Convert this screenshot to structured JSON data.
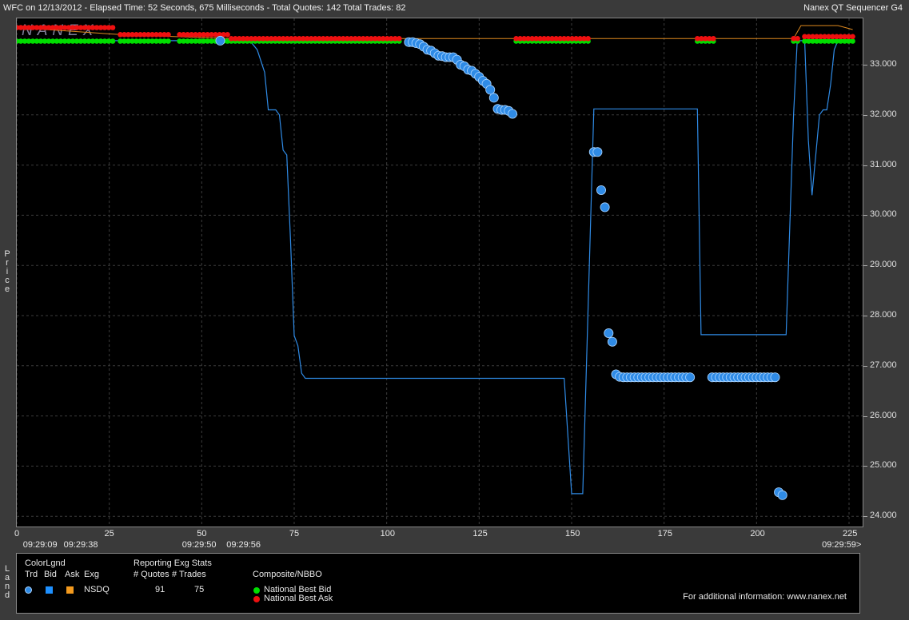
{
  "header": {
    "title": "WFC on 12/13/2012  -  Elapsed Time: 52 Seconds, 675 Milliseconds  -  Total Quotes: 142  Total Trades: 82",
    "app_name": "Nanex QT Sequencer G4",
    "watermark": "NANEX"
  },
  "side_labels": {
    "price": [
      "P",
      "r",
      "i",
      "c",
      "e"
    ],
    "land": [
      "L",
      "a",
      "n",
      "d"
    ]
  },
  "colors": {
    "plot_bg": "#000000",
    "trade": "#2f8be6",
    "trade_outline": "#a9d4ff",
    "bid": "#00dd00",
    "ask": "#ee1010",
    "line": "#2f8be6",
    "ask_line": "#e08a1e"
  },
  "legend": {
    "colorlgnd_title": "ColorLgnd",
    "col_trd": "Trd",
    "col_bid": "Bid",
    "col_ask": "Ask",
    "col_exg": "Exg",
    "exchange": "NSDQ",
    "stats_title": "Reporting Exg Stats",
    "stats_quotes_label": "# Quotes",
    "stats_trades_label": "# Trades",
    "quotes_value": "91",
    "trades_value": "75",
    "composite_title": "Composite/NBBO",
    "nbb_label": "National Best Bid",
    "nbo_label": "National Best Ask",
    "footer": "For additional information: www.nanex.net"
  },
  "chart_data": {
    "type": "scatter",
    "title": "WFC on 12/13/2012",
    "ylabel": "Price",
    "xlabel": "",
    "xlim": [
      0,
      228
    ],
    "ylim": [
      23.85,
      33.75
    ],
    "y_ticks": [
      "33.000",
      "32.000",
      "31.000",
      "30.000",
      "29.000",
      "28.000",
      "27.000",
      "26.000",
      "25.000",
      "24.000"
    ],
    "x_ticks": [
      "0",
      "25",
      "50",
      "75",
      "100",
      "125",
      "150",
      "175",
      "200",
      "225"
    ],
    "time_labels": [
      {
        "x": 6,
        "label": "09:29:09"
      },
      {
        "x": 17,
        "label": "09:29:38"
      },
      {
        "x": 49,
        "label": "09:29:50"
      },
      {
        "x": 61,
        "label": "09:29:56"
      },
      {
        "x": 222,
        "label": "09:29:59>"
      }
    ],
    "series": [
      {
        "name": "Trd",
        "kind": "trades",
        "points": [
          [
            55,
            33.48
          ],
          [
            106,
            33.45
          ],
          [
            107,
            33.45
          ],
          [
            108,
            33.43
          ],
          [
            109,
            33.41
          ],
          [
            110,
            33.36
          ],
          [
            111,
            33.3
          ],
          [
            112,
            33.28
          ],
          [
            113,
            33.23
          ],
          [
            114,
            33.18
          ],
          [
            115,
            33.17
          ],
          [
            116,
            33.15
          ],
          [
            117,
            33.15
          ],
          [
            118,
            33.15
          ],
          [
            119,
            33.1
          ],
          [
            120,
            33.0
          ],
          [
            121,
            32.97
          ],
          [
            122,
            32.9
          ],
          [
            123,
            32.88
          ],
          [
            124,
            32.82
          ],
          [
            125,
            32.76
          ],
          [
            126,
            32.68
          ],
          [
            127,
            32.62
          ],
          [
            128,
            32.5
          ],
          [
            129,
            32.34
          ],
          [
            130,
            32.12
          ],
          [
            131,
            32.1
          ],
          [
            132,
            32.1
          ],
          [
            133,
            32.08
          ],
          [
            134,
            32.02
          ],
          [
            156,
            31.26
          ],
          [
            157,
            31.26
          ],
          [
            158,
            30.5
          ],
          [
            159,
            30.16
          ],
          [
            160,
            27.65
          ],
          [
            161,
            27.48
          ],
          [
            162,
            26.83
          ],
          [
            163,
            26.78
          ],
          [
            164,
            26.77
          ],
          [
            165,
            26.77
          ],
          [
            166,
            26.77
          ],
          [
            167,
            26.77
          ],
          [
            168,
            26.77
          ],
          [
            169,
            26.77
          ],
          [
            170,
            26.77
          ],
          [
            171,
            26.77
          ],
          [
            172,
            26.77
          ],
          [
            173,
            26.77
          ],
          [
            174,
            26.77
          ],
          [
            175,
            26.77
          ],
          [
            176,
            26.77
          ],
          [
            177,
            26.77
          ],
          [
            178,
            26.77
          ],
          [
            179,
            26.77
          ],
          [
            180,
            26.77
          ],
          [
            181,
            26.77
          ],
          [
            182,
            26.77
          ],
          [
            188,
            26.77
          ],
          [
            189,
            26.77
          ],
          [
            190,
            26.77
          ],
          [
            191,
            26.77
          ],
          [
            192,
            26.77
          ],
          [
            193,
            26.77
          ],
          [
            194,
            26.77
          ],
          [
            195,
            26.77
          ],
          [
            196,
            26.77
          ],
          [
            197,
            26.77
          ],
          [
            198,
            26.77
          ],
          [
            199,
            26.77
          ],
          [
            200,
            26.77
          ],
          [
            201,
            26.77
          ],
          [
            202,
            26.77
          ],
          [
            203,
            26.77
          ],
          [
            204,
            26.77
          ],
          [
            205,
            26.77
          ],
          [
            206,
            24.48
          ],
          [
            207,
            24.42
          ]
        ]
      },
      {
        "name": "Trade line",
        "kind": "line",
        "points": [
          [
            0,
            33.48
          ],
          [
            63,
            33.48
          ],
          [
            65,
            33.3
          ],
          [
            67,
            32.85
          ],
          [
            68,
            32.1
          ],
          [
            70,
            32.1
          ],
          [
            71,
            32.0
          ],
          [
            72,
            31.3
          ],
          [
            73,
            31.2
          ],
          [
            74,
            29.5
          ],
          [
            75,
            27.6
          ],
          [
            76,
            27.4
          ],
          [
            77,
            26.85
          ],
          [
            78,
            26.75
          ],
          [
            148,
            26.75
          ],
          [
            150,
            24.45
          ],
          [
            153,
            24.45
          ],
          [
            156,
            32.12
          ],
          [
            184,
            32.12
          ],
          [
            185,
            27.62
          ],
          [
            208,
            27.62
          ],
          [
            210,
            32.0
          ],
          [
            211,
            33.48
          ],
          [
            213,
            33.48
          ],
          [
            214,
            31.5
          ],
          [
            215,
            30.4
          ],
          [
            216,
            31.2
          ],
          [
            217,
            32.0
          ],
          [
            218,
            32.1
          ],
          [
            219,
            32.1
          ],
          [
            220,
            32.6
          ],
          [
            221,
            33.3
          ],
          [
            222,
            33.48
          ],
          [
            226,
            33.48
          ]
        ]
      },
      {
        "name": "National Best Ask",
        "kind": "ask",
        "color": "#ee1010",
        "segments": [
          [
            0,
            27,
            33.74
          ],
          [
            28,
            42,
            33.6
          ],
          [
            44,
            57,
            33.6
          ],
          [
            58,
            104,
            33.52
          ],
          [
            135,
            155,
            33.52
          ],
          [
            184,
            189,
            33.52
          ],
          [
            210,
            212,
            33.52
          ],
          [
            213,
            226,
            33.56
          ]
        ]
      },
      {
        "name": "National Best Bid",
        "kind": "bid",
        "color": "#00dd00",
        "segments": [
          [
            0,
            27,
            33.47
          ],
          [
            28,
            42,
            33.47
          ],
          [
            44,
            57,
            33.47
          ],
          [
            58,
            104,
            33.47
          ],
          [
            135,
            155,
            33.47
          ],
          [
            184,
            189,
            33.47
          ],
          [
            210,
            212,
            33.47
          ],
          [
            213,
            226,
            33.47
          ]
        ]
      },
      {
        "name": "Ask line",
        "kind": "askline",
        "color": "#e08a1e",
        "points": [
          [
            0,
            33.74
          ],
          [
            28,
            33.6
          ],
          [
            58,
            33.52
          ],
          [
            210,
            33.52
          ],
          [
            212,
            33.78
          ],
          [
            222,
            33.78
          ],
          [
            226,
            33.7
          ]
        ]
      }
    ],
    "grid": true,
    "legend_position": "bottom"
  }
}
